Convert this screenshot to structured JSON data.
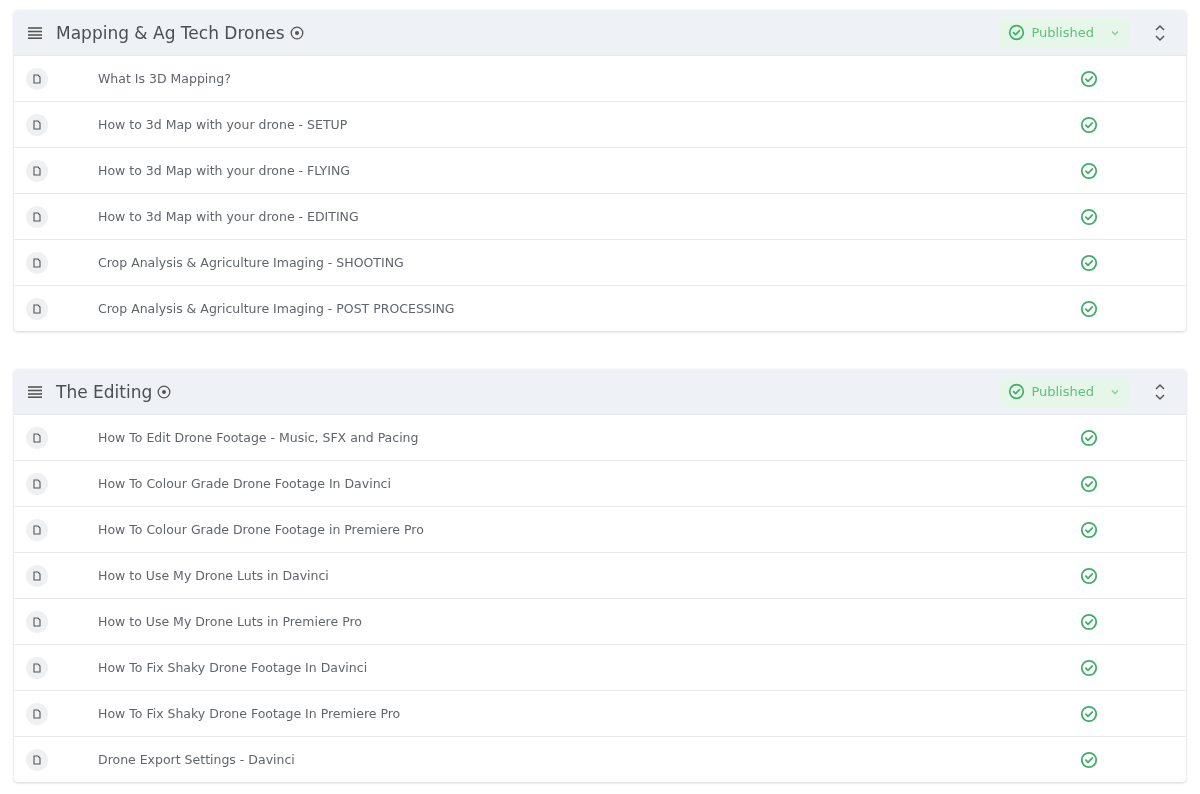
{
  "sections": [
    {
      "title": "Mapping & Ag Tech Drones",
      "status": "Published",
      "lessons": [
        {
          "title": "What Is 3D Mapping?",
          "published": true
        },
        {
          "title": "How to 3d Map with your drone - SETUP",
          "published": true
        },
        {
          "title": "How to 3d Map with your drone - FLYING",
          "published": true
        },
        {
          "title": "How to 3d Map with your drone - EDITING",
          "published": true
        },
        {
          "title": "Crop Analysis & Agriculture Imaging - SHOOTING",
          "published": true
        },
        {
          "title": "Crop Analysis & Agriculture Imaging - POST PROCESSING",
          "published": true
        }
      ]
    },
    {
      "title": "The Editing",
      "status": "Published",
      "lessons": [
        {
          "title": "How To Edit Drone Footage - Music, SFX and Pacing",
          "published": true
        },
        {
          "title": "How To Colour Grade Drone Footage In Davinci",
          "published": true
        },
        {
          "title": "How To Colour Grade Drone Footage in Premiere Pro",
          "published": true
        },
        {
          "title": "How to Use My Drone Luts in Davinci",
          "published": true
        },
        {
          "title": "How to Use My Drone Luts in Premiere Pro",
          "published": true
        },
        {
          "title": "How To Fix Shaky Drone Footage In Davinci",
          "published": true
        },
        {
          "title": "How To Fix Shaky Drone Footage In Premiere Pro",
          "published": true
        },
        {
          "title": "Drone Export Settings - Davinci",
          "published": true
        }
      ]
    }
  ]
}
